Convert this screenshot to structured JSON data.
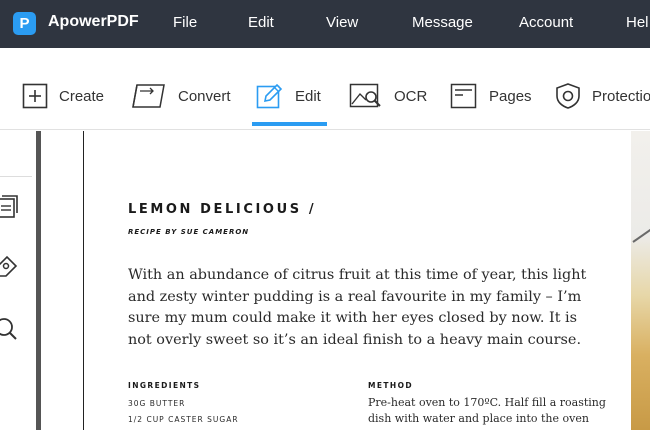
{
  "app": {
    "name": "ApowerPDF",
    "logo_letter": "P",
    "accent": "#2b9cf2",
    "menubar_bg": "#2f3540"
  },
  "menu": {
    "items": [
      "File",
      "Edit",
      "View",
      "Message",
      "Account",
      "Hel"
    ]
  },
  "toolbar": {
    "active": "Edit",
    "tools": [
      {
        "label": "Create",
        "icon": "plus-square-icon"
      },
      {
        "label": "Convert",
        "icon": "convert-icon"
      },
      {
        "label": "Edit",
        "icon": "edit-pencil-icon"
      },
      {
        "label": "OCR",
        "icon": "ocr-icon"
      },
      {
        "label": "Pages",
        "icon": "pages-icon"
      },
      {
        "label": "Protectio",
        "icon": "shield-icon"
      }
    ]
  },
  "left_panel": {
    "icons": [
      "thumbnails-icon",
      "bookmark-tag-icon",
      "search-icon"
    ]
  },
  "document": {
    "title": "LEMON DELICIOUS /",
    "byline": "RECIPE BY SUE CAMERON",
    "intro_lines": [
      "With an abundance of citrus fruit at this time of year, this light",
      "and zesty winter pudding is a real favourite in my family – I’m",
      "sure my mum could make it with her eyes closed by now. It is",
      "not overly sweet so it’s an ideal finish to a heavy main course."
    ],
    "ingredients_heading": "INGREDIENTS",
    "ingredients": [
      "30G BUTTER",
      "1/2 CUP CASTER SUGAR"
    ],
    "method_heading": "METHOD",
    "method_lines": [
      "Pre-heat oven to 170ºC. Half fill a roasting",
      "dish with water and place into the oven"
    ]
  }
}
